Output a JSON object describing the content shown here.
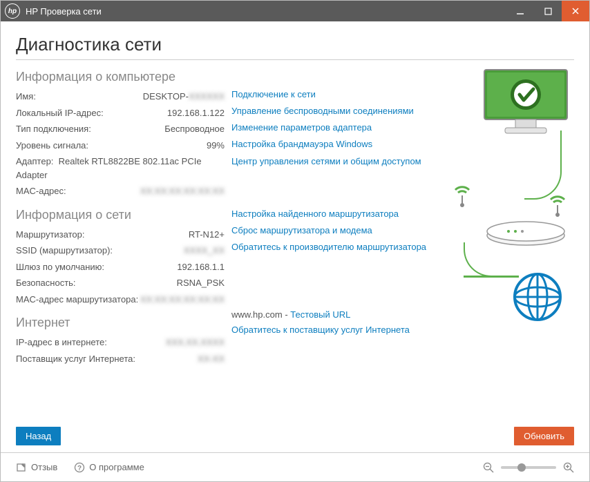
{
  "titlebar": {
    "app_name": "HP Проверка сети"
  },
  "page_title": "Диагностика сети",
  "sections": {
    "computer": {
      "title": "Информация о компьютере",
      "items": {
        "name_label": "Имя:",
        "name_value_prefix": "DESKTOP-",
        "name_value_blur": "XXXXXX",
        "local_ip_label": "Локальный IP-адрес:",
        "local_ip_value": "192.168.1.122",
        "conn_type_label": "Тип подключения:",
        "conn_type_value": "Беспроводное",
        "signal_label": "Уровень сигнала:",
        "signal_value": "99%",
        "adapter_label": "Адаптер:",
        "adapter_value": "Realtek RTL8822BE 802.11ac PCIe Adapter",
        "mac_label": "MAC-адрес:",
        "mac_value_blur": "XX:XX:XX:XX:XX:XX"
      },
      "links": [
        "Подключение к сети",
        "Управление беспроводными соединениями",
        "Изменение параметров адаптера",
        "Настройка брандмауэра Windows",
        "Центр управления сетями и общим доступом"
      ]
    },
    "network": {
      "title": "Информация о сети",
      "items": {
        "router_label": "Маршрутизатор:",
        "router_value": "RT-N12+",
        "ssid_label": "SSID (маршрутизатор):",
        "ssid_value_blur": "XXXX_XX",
        "gateway_label": "Шлюз по умолчанию:",
        "gateway_value": "192.168.1.1",
        "security_label": "Безопасность:",
        "security_value": "RSNA_PSK",
        "router_mac_label": "MAC-адрес маршрутизатора:",
        "router_mac_value_blur": "XX:XX:XX:XX:XX:XX"
      },
      "links": [
        "Настройка найденного маршрутизатора",
        "Сброс маршрутизатора и модема",
        "Обратитесь к производителю маршрутизатора"
      ]
    },
    "internet": {
      "title": "Интернет",
      "items": {
        "ip_label": "IP-адрес в интернете:",
        "ip_value_blur": "XXX.XX.XXXX",
        "isp_label": "Поставщик услуг Интернета:",
        "isp_value_blur": "XX-XX"
      },
      "hp_url": "www.hp.com",
      "test_url": "Тестовый URL",
      "isp_link": "Обратитесь к поставщику услуг Интернета"
    }
  },
  "buttons": {
    "back": "Назад",
    "refresh": "Обновить"
  },
  "footer": {
    "feedback": "Отзыв",
    "about": "О программе"
  }
}
